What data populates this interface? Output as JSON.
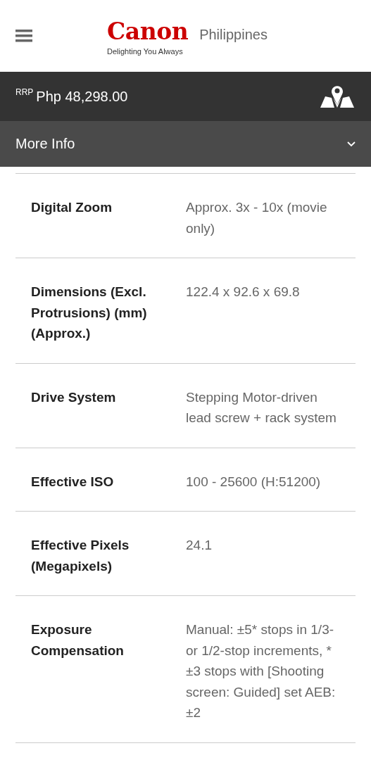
{
  "header": {
    "logo": "Canon",
    "region": "Philippines",
    "tagline": "Delighting You Always"
  },
  "price_bar": {
    "label": "RRP",
    "price": "Php 48,298.00"
  },
  "section": {
    "title": "More Info",
    "expanded": true
  },
  "specs": [
    {
      "label": "Digital Zoom",
      "value": "Approx. 3x - 10x (movie only)"
    },
    {
      "label": "Dimensions (Excl. Protrusions) (mm) (Approx.)",
      "value": "122.4 x 92.6 x 69.8"
    },
    {
      "label": "Drive System",
      "value": "Stepping Motor-driven lead screw + rack system"
    },
    {
      "label": "Effective ISO",
      "value": "100 - 25600 (H:51200)"
    },
    {
      "label": "Effective Pixels (Megapixels)",
      "value": "24.1"
    },
    {
      "label": "Exposure Compensation",
      "value": "Manual: ±5* stops in 1/3- or 1/2-stop increments, * ±3 stops with [Shooting screen: Guided] set AEB: ±2"
    }
  ]
}
